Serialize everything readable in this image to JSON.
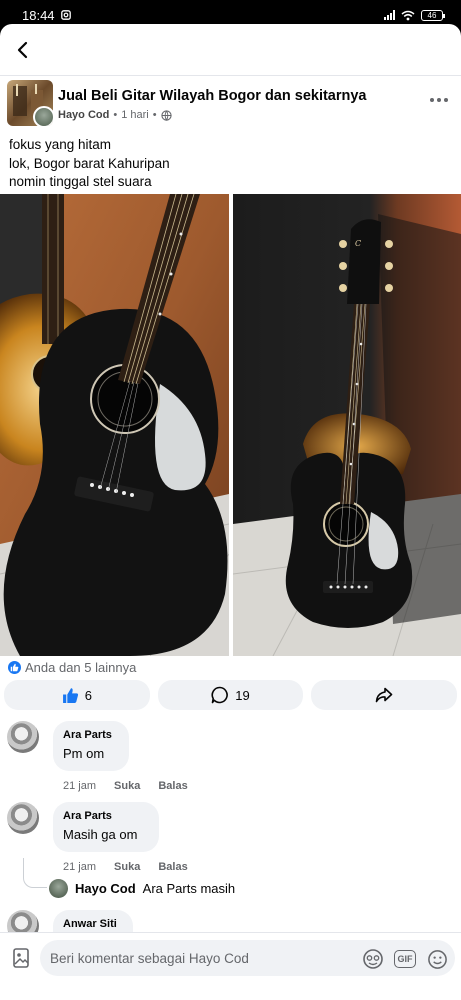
{
  "status_bar": {
    "time": "18:44",
    "battery": "46"
  },
  "post": {
    "group_name": "Jual Beli Gitar Wilayah Bogor dan sekitarnya",
    "author": "Hayo Cod",
    "time": "1 hari",
    "text_lines": [
      "fokus yang hitam",
      "lok, Bogor barat Kahuripan",
      "nomin tinggal stel suara"
    ]
  },
  "reactions": {
    "summary": "Anda dan 5 lainnya"
  },
  "actions": {
    "like_count": "6",
    "comment_count": "19"
  },
  "comments": [
    {
      "name": "Ara Parts",
      "text": "Pm om",
      "time": "21 jam",
      "like": "Suka",
      "reply": "Balas"
    },
    {
      "name": "Ara Parts",
      "text": "Masih ga om",
      "time": "21 jam",
      "like": "Suka",
      "reply": "Balas"
    },
    {
      "name": "Anwar Siti",
      "text": ""
    }
  ],
  "reply_preview": {
    "name": "Hayo Cod",
    "text": "Ara Parts masih"
  },
  "composer": {
    "placeholder": "Beri komentar sebagai Hayo Cod"
  },
  "icons": {
    "back": "back-arrow-icon",
    "more": "more-icon",
    "globe": "globe-icon",
    "like": "thumbs-up-icon",
    "comment": "comment-icon",
    "share": "share-icon",
    "gallery": "gallery-icon",
    "sticker": "sticker-icon",
    "gif": "gif-icon",
    "emoji": "emoji-icon"
  },
  "colors": {
    "accent": "#1877f2",
    "bubble": "#f0f2f5",
    "muted": "#65676b"
  }
}
